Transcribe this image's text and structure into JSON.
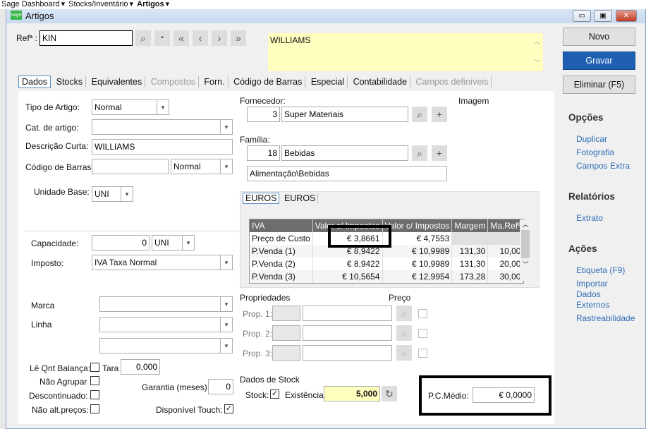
{
  "breadcrumb": [
    "Sage Dashboard",
    "Stocks/Inventário",
    "Artigos"
  ],
  "window": {
    "title": "Artigos",
    "logo": "sage"
  },
  "header": {
    "ref_label": "Refª :",
    "ref_value": "KIN",
    "description": "WILLIAMS"
  },
  "tabs": [
    {
      "label": "Dados",
      "active": true
    },
    {
      "label": "Stocks"
    },
    {
      "label": "Equivalentes"
    },
    {
      "label": "Compostos",
      "disabled": true
    },
    {
      "label": "Forn."
    },
    {
      "label": "Código de Barras"
    },
    {
      "label": "Especial"
    },
    {
      "label": "Contabilidade"
    },
    {
      "label": "Campos definíveis",
      "disabled": true
    }
  ],
  "form": {
    "tipo_label": "Tipo de Artigo:",
    "tipo_value": "Normal",
    "cat_label": "Cat. de artigo:",
    "cat_value": "",
    "desc_label": "Descrição Curta:",
    "desc_value": "WILLIAMS",
    "barcode_label": "Código de Barras:",
    "barcode_value": "",
    "barcode_type": "Normal",
    "unidade_label": "Unidade Base:",
    "unidade_value": "UNI",
    "cap_label": "Capacidade:",
    "cap_value": "0",
    "cap_unit": "UNI",
    "imposto_label": "Imposto:",
    "imposto_value": "IVA Taxa Normal",
    "marca_label": "Marca",
    "linha_label": "Linha",
    "le_qnt_label": "Lê Qnt Balança:",
    "tara_label": "Tara",
    "tara_value": "0,000",
    "nao_agrupar_label": "Não Agrupar",
    "descontinuado_label": "Descontinuado:",
    "nao_alt_label": "Não alt.preços:",
    "garantia_label": "Garantia (meses):",
    "garantia_value": "0",
    "touch_label": "Disponível Touch:",
    "touch_checked": true
  },
  "fornecedor": {
    "label": "Fornecedor:",
    "code": "3",
    "name": "Super Materiais"
  },
  "imagem_label": "Imagem",
  "familia": {
    "label": "Família:",
    "code": "18",
    "name": "Bebidas",
    "path": "Alimentação\\Bebidas"
  },
  "currency_tabs": [
    "EUROS",
    "EUROS"
  ],
  "price_table": {
    "headers": [
      "IVA",
      "Valor s/ Impostos",
      "Valor c/ Impostos",
      "Margem",
      "Ma.Refª"
    ],
    "rows": [
      [
        "Preço de Custo",
        "€ 3,8661",
        "€ 4,7553",
        "",
        ""
      ],
      [
        "P.Venda (1)",
        "€ 8,9422",
        "€ 10,9989",
        "131,30",
        "10,00"
      ],
      [
        "P.Venda (2)",
        "€ 8,9422",
        "€ 10,9989",
        "131,30",
        "20,00"
      ],
      [
        "P.Venda (3)",
        "€ 10,5654",
        "€ 12,9954",
        "173,28",
        "30,00"
      ]
    ]
  },
  "propriedades": {
    "label": "Propriedades",
    "preco_label": "Preço",
    "props": [
      "Prop. 1:",
      "Prop. 2:",
      "Prop. 3:"
    ]
  },
  "stock": {
    "label": "Dados de Stock",
    "stock_label": "Stock:",
    "existencia_label": "Existência:",
    "existencia_value": "5,000",
    "pcm_label": "P.C.Médio:",
    "pcm_value": "€ 0,0000"
  },
  "actions": {
    "novo": "Novo",
    "gravar": "Gravar",
    "eliminar": "Eliminar (F5)"
  },
  "sidebar": {
    "opcoes": "Opções",
    "opcoes_items": [
      "Duplicar",
      "Fotografia",
      "Campos Extra"
    ],
    "relatorios": "Relatórios",
    "relatorios_items": [
      "Extrato"
    ],
    "acoes": "Ações",
    "acoes_items": [
      "Etiqueta (F9)",
      "Importar Dados Externos",
      "Rastreabilidade"
    ]
  },
  "colors": {
    "accent": "#1e5fb3",
    "highlight": "#ffffc0",
    "link": "#2f6fb8"
  }
}
